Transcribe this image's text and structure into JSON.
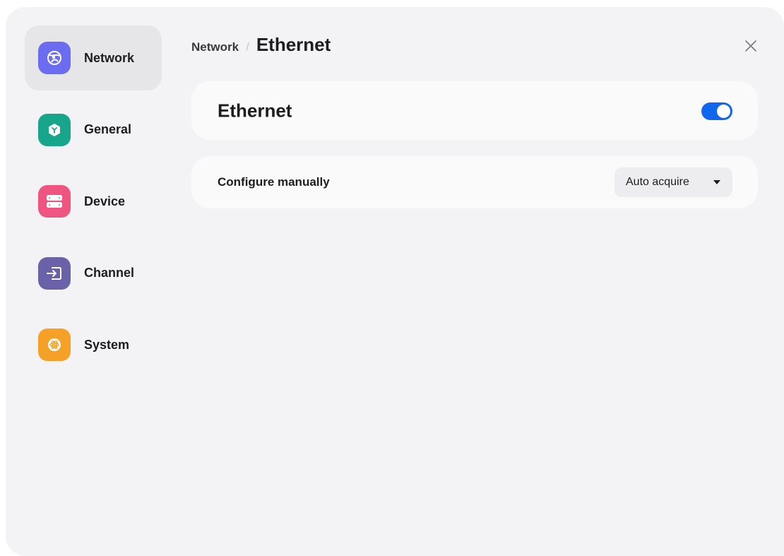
{
  "sidebar": {
    "items": [
      {
        "label": "Network",
        "icon": "globe-icon",
        "color": "#6c6cf0",
        "active": true
      },
      {
        "label": "General",
        "icon": "cube-icon",
        "color": "#17a58c",
        "active": false
      },
      {
        "label": "Device",
        "icon": "server-icon",
        "color": "#ee5580",
        "active": false
      },
      {
        "label": "Channel",
        "icon": "input-icon",
        "color": "#6a62a8",
        "active": false
      },
      {
        "label": "System",
        "icon": "atom-icon",
        "color": "#f5a128",
        "active": false
      }
    ]
  },
  "header": {
    "breadcrumb_parent": "Network",
    "breadcrumb_separator": "/",
    "breadcrumb_current": "Ethernet",
    "close_icon": "close-icon"
  },
  "ethernet": {
    "title": "Ethernet",
    "enabled": true,
    "toggle_color": "#1166ee"
  },
  "configure": {
    "label": "Configure manually",
    "selected": "Auto acquire",
    "dropdown_icon": "caret-down-icon"
  }
}
